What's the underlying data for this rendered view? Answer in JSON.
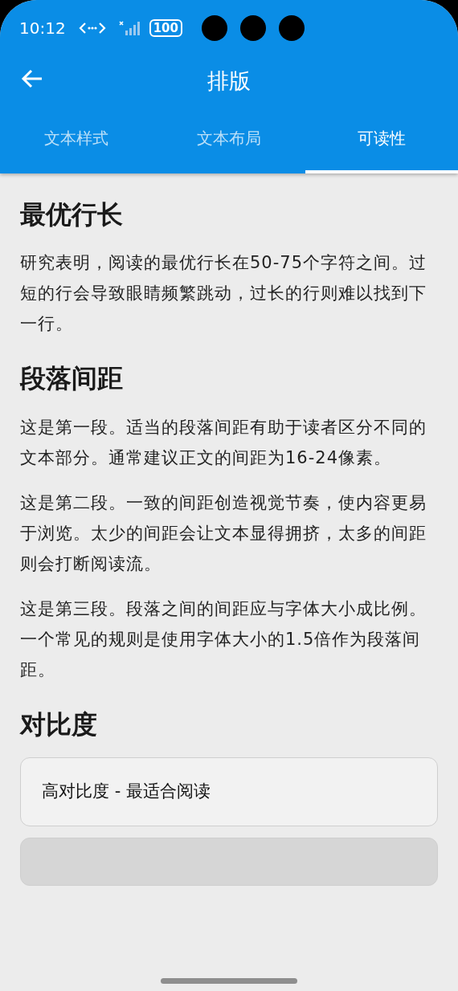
{
  "status_bar": {
    "time": "10:12",
    "battery": "100"
  },
  "header": {
    "title": "排版"
  },
  "tabs": [
    {
      "label": "文本样式",
      "selected": false
    },
    {
      "label": "文本布局",
      "selected": false
    },
    {
      "label": "可读性",
      "selected": true
    }
  ],
  "sections": [
    {
      "heading": "最优行长",
      "paragraphs": [
        "研究表明，阅读的最优行长在50-75个字符之间。过短的行会导致眼睛频繁跳动，过长的行则难以找到下一行。"
      ]
    },
    {
      "heading": "段落间距",
      "paragraphs": [
        "这是第一段。适当的段落间距有助于读者区分不同的文本部分。通常建议正文的间距为16-24像素。",
        "这是第二段。一致的间距创造视觉节奏，使内容更易于浏览。太少的间距会让文本显得拥挤，太多的间距则会打断阅读流。",
        "这是第三段。段落之间的间距应与字体大小成比例。一个常见的规则是使用字体大小的1.5倍作为段落间距。"
      ]
    },
    {
      "heading": "对比度",
      "cards": [
        {
          "kind": "text",
          "label": "高对比度 - 最适合阅读"
        },
        {
          "kind": "muted"
        }
      ]
    }
  ]
}
